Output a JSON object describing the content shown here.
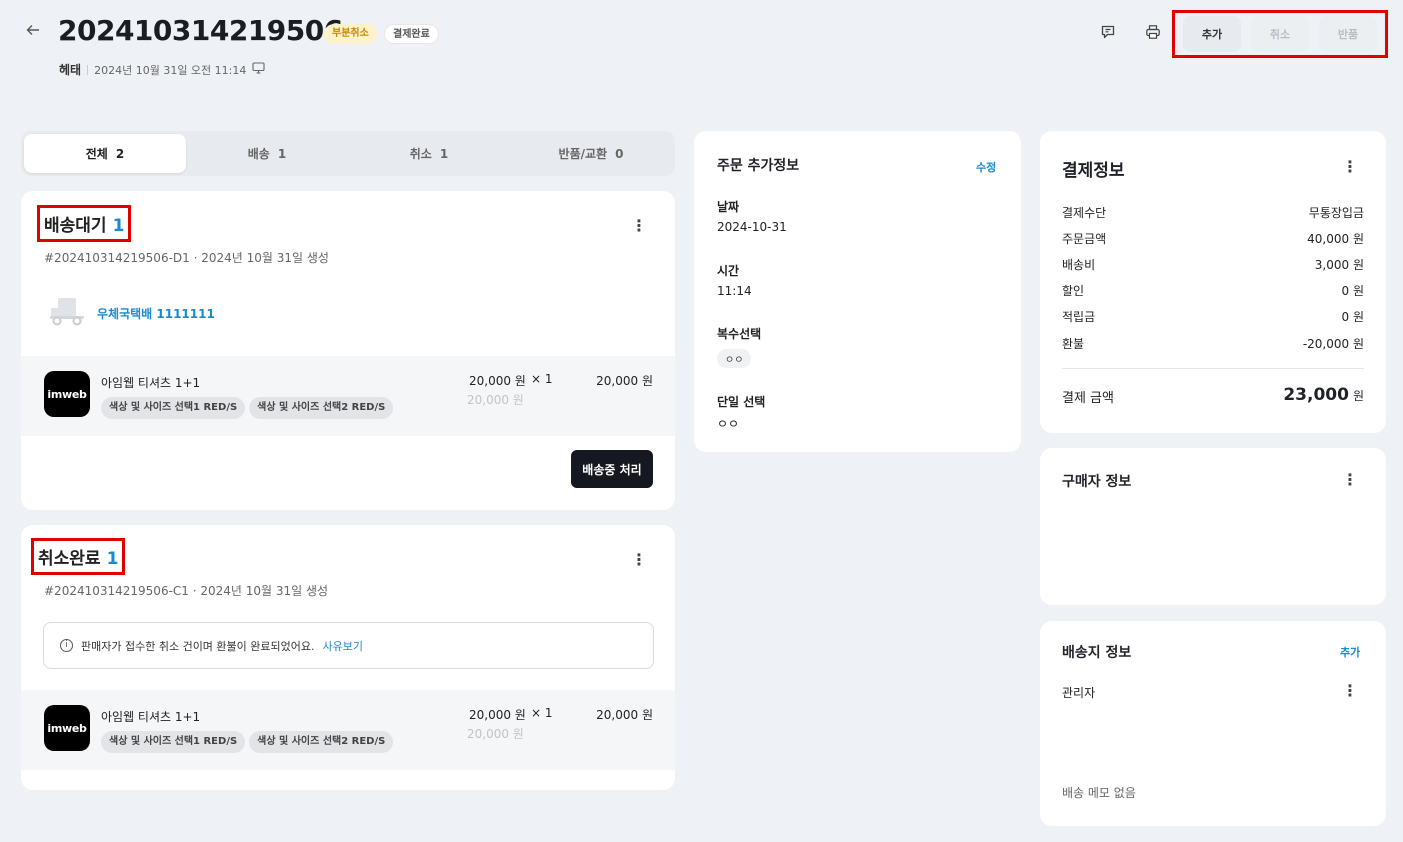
{
  "header": {
    "order_number": "202410314219506",
    "badge_partial": "부분취소",
    "badge_paid": "결제완료",
    "channel": "헤태",
    "datetime": "2024년 10월 31일 오전 11:14",
    "actions": [
      {
        "label": "추가",
        "enabled": true
      },
      {
        "label": "취소",
        "enabled": false
      },
      {
        "label": "반품",
        "enabled": false
      }
    ]
  },
  "tabs": [
    {
      "label": "전체",
      "count": "2"
    },
    {
      "label": "배송",
      "count": "1"
    },
    {
      "label": "취소",
      "count": "1"
    },
    {
      "label": "반품/교환",
      "count": "0"
    }
  ],
  "shipment": {
    "title": "배송대기",
    "count": "1",
    "meta": "#202410314219506-D1 · 2024년 10월 31일 생성",
    "tracking": "우체국택배 1111111",
    "item": {
      "logo": "imweb",
      "name": "아임웹 티셔츠 1+1",
      "options": [
        "색상 및 사이즈 선택1 RED/S",
        "색상 및 사이즈 선택2 RED/S"
      ],
      "price": "20,000 원",
      "original_price": "20,000 원",
      "qty": "× 1",
      "total": "20,000 원"
    },
    "action_label": "배송중 처리"
  },
  "cancel": {
    "title": "취소완료",
    "count": "1",
    "meta": "#202410314219506-C1 · 2024년 10월 31일 생성",
    "notice": "판매자가 접수한 취소 건이며 환불이 완료되었어요.",
    "notice_link": "사유보기",
    "item": {
      "logo": "imweb",
      "name": "아임웹 티셔츠 1+1",
      "options": [
        "색상 및 사이즈 선택1 RED/S",
        "색상 및 사이즈 선택2 RED/S"
      ],
      "price": "20,000 원",
      "original_price": "20,000 원",
      "qty": "× 1",
      "total": "20,000 원"
    }
  },
  "extra_info": {
    "title": "주문 추가정보",
    "edit_label": "수정",
    "fields": [
      {
        "label": "날짜",
        "value": "2024-10-31"
      },
      {
        "label": "시간",
        "value": "11:14"
      },
      {
        "label": "복수선택",
        "value": "ㅇㅇ"
      },
      {
        "label": "단일 선택",
        "value": "ㅇㅇ"
      }
    ]
  },
  "payment": {
    "title": "결제정보",
    "rows": [
      {
        "label": "결제수단",
        "value": "무통장입금"
      },
      {
        "label": "주문금액",
        "value": "40,000 원"
      },
      {
        "label": "배송비",
        "value": "3,000 원"
      },
      {
        "label": "할인",
        "value": "0 원"
      },
      {
        "label": "적립금",
        "value": "0 원"
      },
      {
        "label": "환불",
        "value": "-20,000 원"
      }
    ],
    "total_label": "결제 금액",
    "total_value": "23,000",
    "total_unit": "원"
  },
  "buyer": {
    "title": "구매자 정보"
  },
  "shipping_address": {
    "title": "배송지 정보",
    "add_label": "추가",
    "recipient": "관리자",
    "memo": "배송 메모 없음"
  }
}
